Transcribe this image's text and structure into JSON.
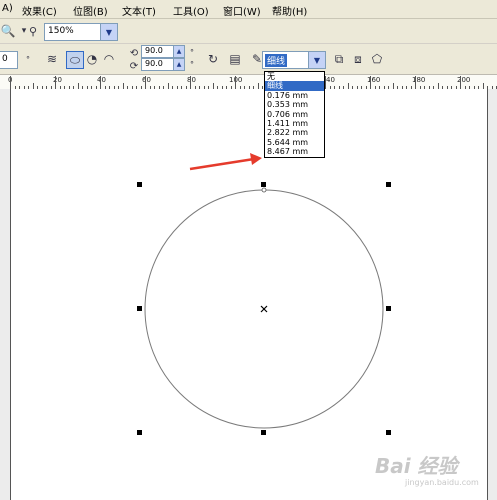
{
  "menubar": {
    "items": [
      {
        "label": "A)"
      },
      {
        "label": "效果(C)"
      },
      {
        "label": "位图(B)"
      },
      {
        "label": "文本(T)"
      },
      {
        "label": "工具(O)"
      },
      {
        "label": "窗口(W)"
      },
      {
        "label": "帮助(H)"
      }
    ]
  },
  "toolbar1": {
    "zoom_value": "150%"
  },
  "toolbar2": {
    "left_value": "0",
    "angle1": "90.0",
    "angle2": "90.0",
    "outline_width_value": "细线"
  },
  "ruler": {
    "labels": [
      "0",
      "20",
      "40",
      "60",
      "80",
      "100",
      "40",
      "160",
      "180",
      "200"
    ]
  },
  "outline_dropdown": {
    "options": [
      "无",
      "细线",
      "0.176 mm",
      "0.353 mm",
      "0.706 mm",
      "1.411 mm",
      "2.822 mm",
      "5.644 mm",
      "8.467 mm"
    ],
    "selected_index": 1
  },
  "watermark": {
    "text": "Bai 经验",
    "sub": "jingyan.baidu.com"
  },
  "colors": {
    "arrow": "#e53b2c",
    "selection": "#316ac5",
    "ui_bg": "#ece9d8"
  }
}
